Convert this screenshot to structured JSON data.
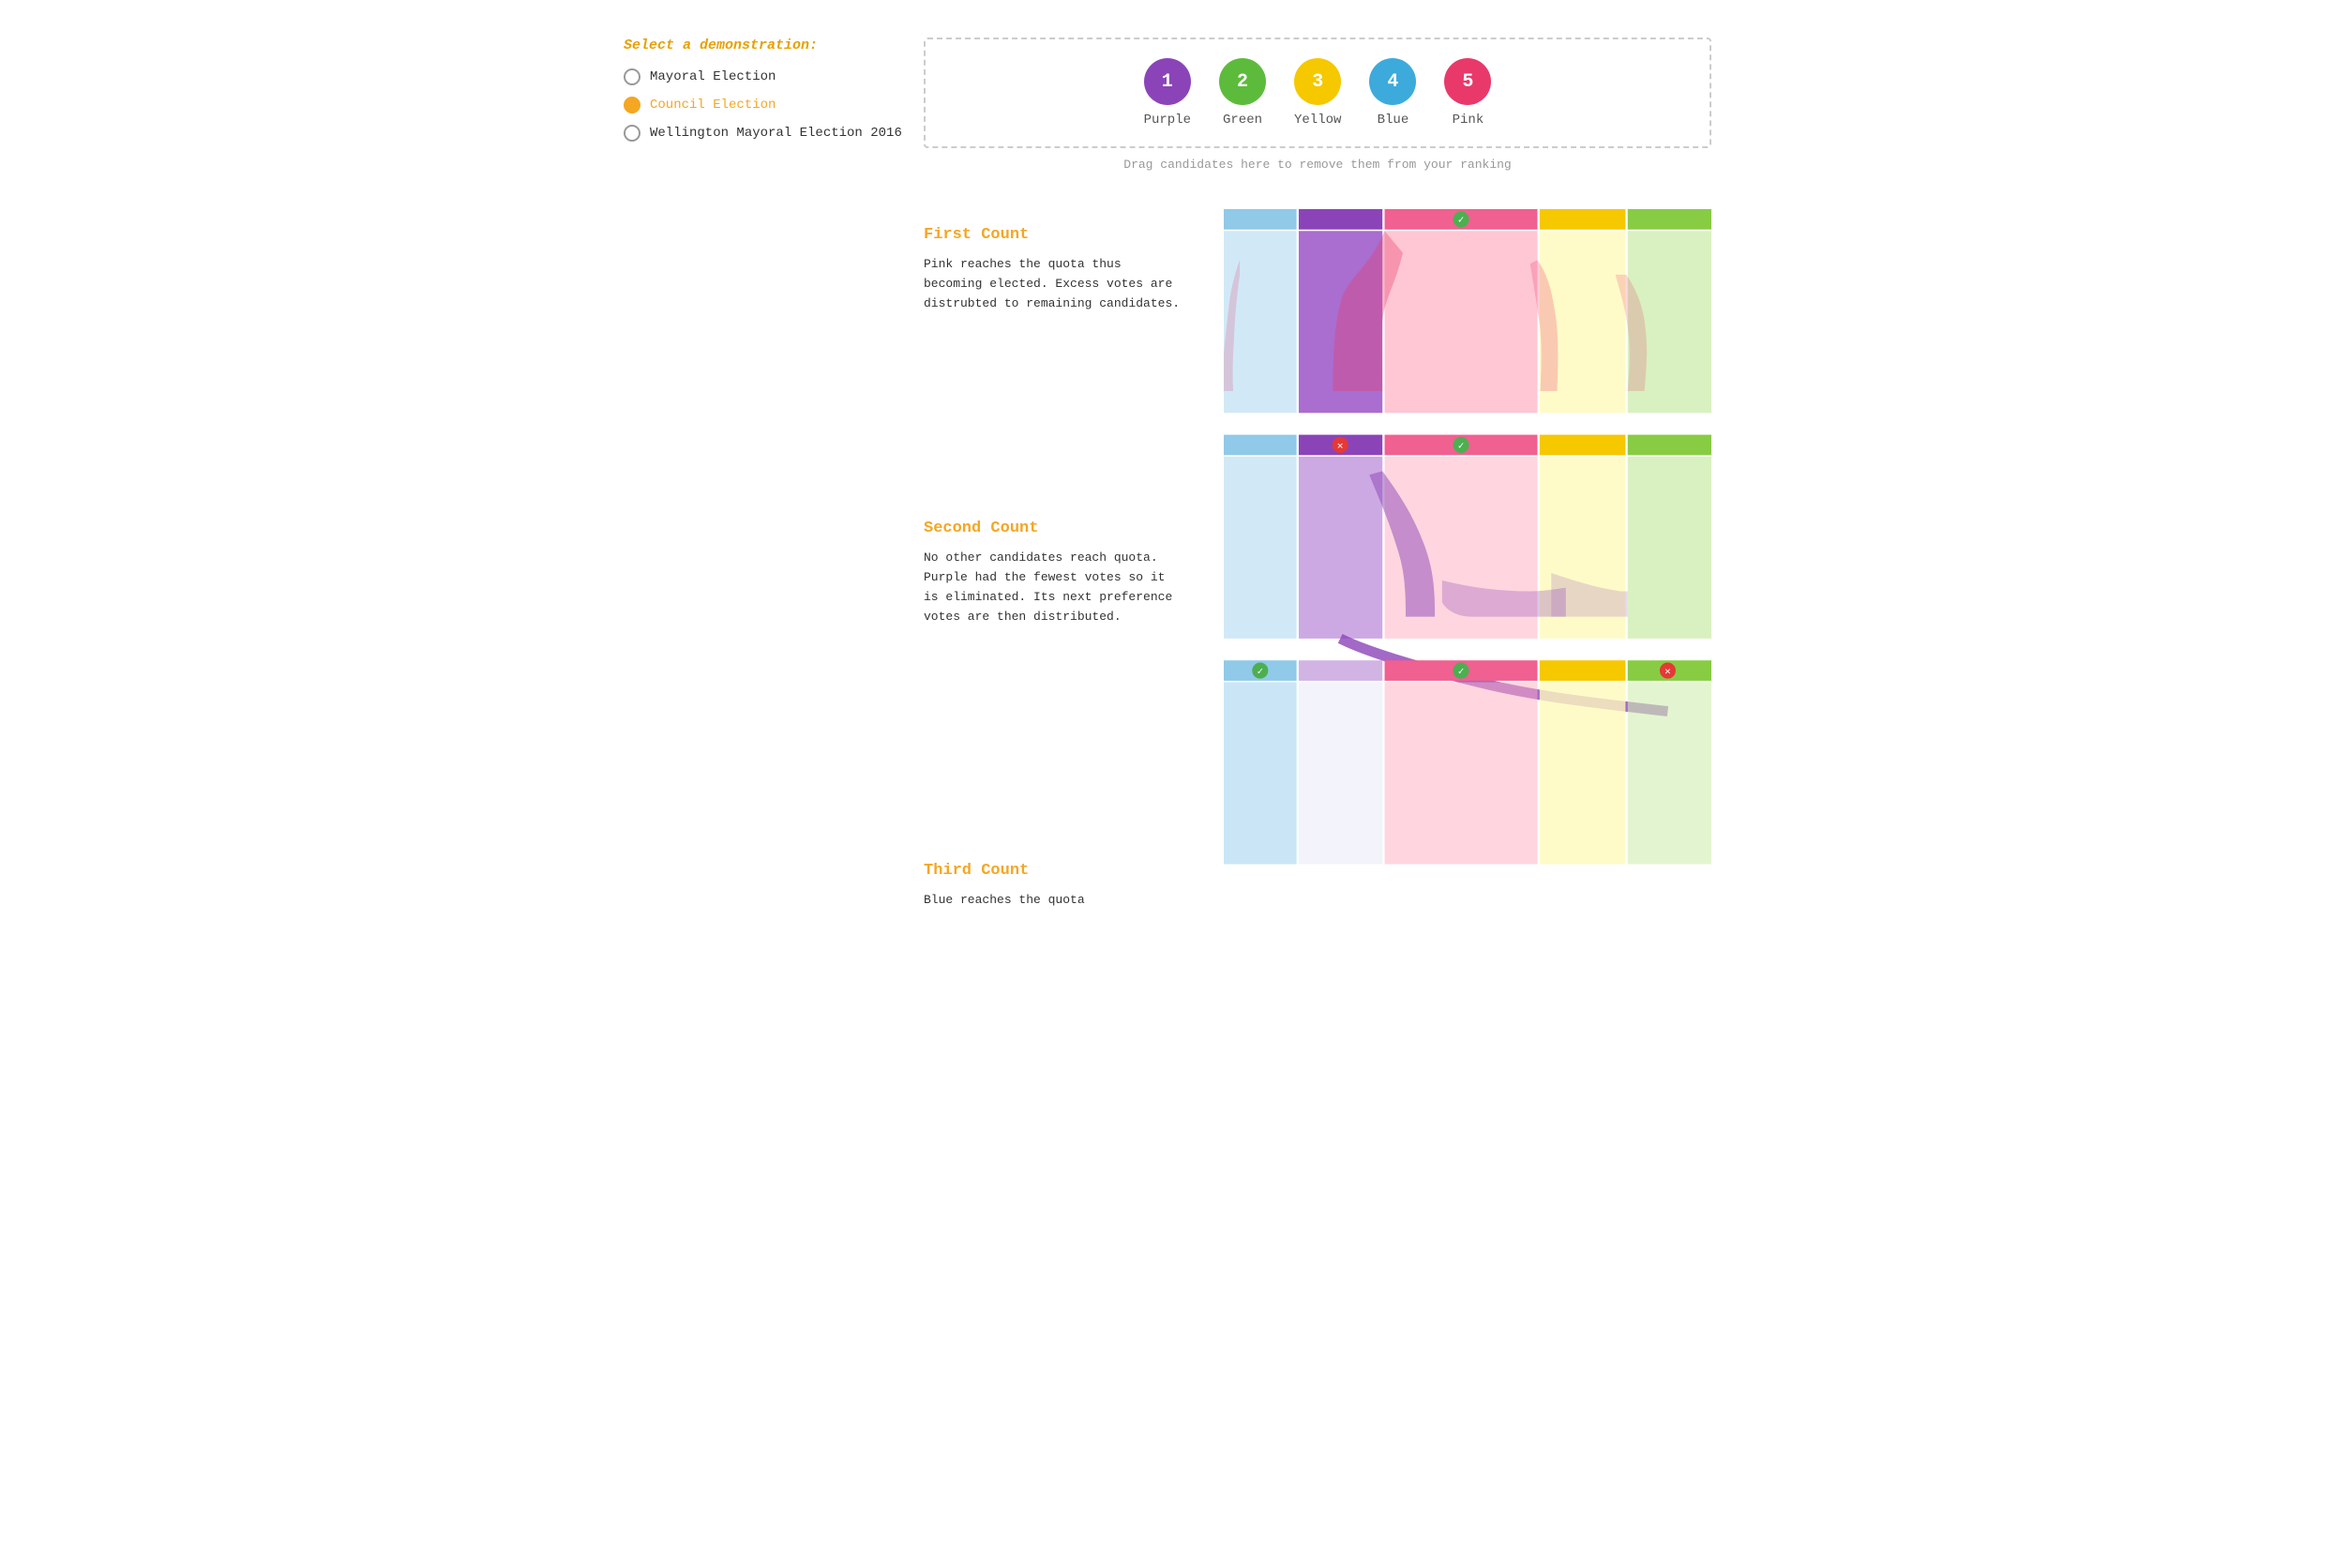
{
  "demo_selector": {
    "label": "Select a demonstration:",
    "options": [
      {
        "id": "mayoral",
        "label": "Mayoral Election",
        "selected": false
      },
      {
        "id": "council",
        "label": "Council Election",
        "selected": true
      },
      {
        "id": "wellington",
        "label": "Wellington Mayoral Election 2016",
        "selected": false
      }
    ]
  },
  "candidates": [
    {
      "id": 1,
      "label": "1",
      "name": "Purple",
      "color": "#8B44B8"
    },
    {
      "id": 2,
      "label": "2",
      "name": "Green",
      "color": "#5DBB3C"
    },
    {
      "id": 3,
      "label": "3",
      "name": "Yellow",
      "color": "#F5C800"
    },
    {
      "id": 4,
      "label": "4",
      "name": "Blue",
      "color": "#3DAADC"
    },
    {
      "id": 5,
      "label": "5",
      "name": "Pink",
      "color": "#E8396A"
    }
  ],
  "drag_hint": "Drag candidates here to remove them from your ranking",
  "counts": [
    {
      "id": "first",
      "title": "First Count",
      "description": "Pink reaches the quota thus becoming elected. Excess votes are distrubted to remaining candidates."
    },
    {
      "id": "second",
      "title": "Second Count",
      "description": "No other candidates reach quota. Purple had the fewest votes so it is eliminated. Its next preference votes are then distributed."
    },
    {
      "id": "third",
      "title": "Third Count",
      "description": "Blue reaches the quota"
    }
  ],
  "colors": {
    "blue_light": "#91C9E8",
    "purple": "#8B44B8",
    "pink": "#F48FB1",
    "yellow_light": "#FFF0A0",
    "green_light": "#C8E6A0",
    "pink_header": "#F06090",
    "yellow_header": "#F5C800",
    "green_header": "#88CC44",
    "blue_header": "#55BBEE",
    "check_green": "#4CAF50",
    "cross_red": "#E53935"
  }
}
